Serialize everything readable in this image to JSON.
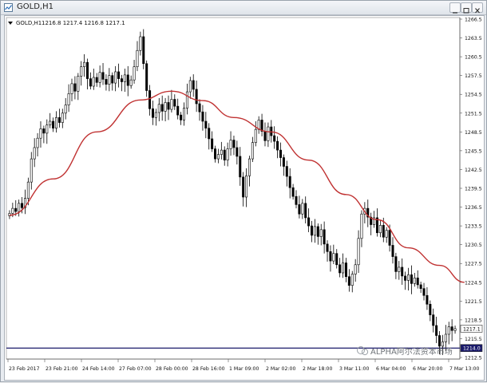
{
  "window": {
    "title": "GOLD,H1"
  },
  "chart_data": {
    "type": "candlestick",
    "symbol": "GOLD,H1",
    "info_line": "1216.8 1217.4 1216.8 1217.1",
    "ylim": [
      1212.5,
      1266.5
    ],
    "y_ticks": [
      "1266.5",
      "1263.5",
      "1260.5",
      "1257.5",
      "1254.5",
      "1251.5",
      "1248.5",
      "1245.5",
      "1242.5",
      "1239.5",
      "1236.5",
      "1233.5",
      "1230.5",
      "1227.5",
      "1224.5",
      "1221.5",
      "1218.5",
      "1215.5",
      "1212.5"
    ],
    "x_ticks": [
      "23 Feb 2017",
      "23 Feb 21:00",
      "24 Feb 14:00",
      "27 Feb 07:00",
      "28 Feb 00:00",
      "28 Feb 16:00",
      "1 Mar 09:00",
      "2 Mar 02:00",
      "2 Mar 18:00",
      "3 Mar 11:00",
      "6 Mar 04:00",
      "6 Mar 20:00",
      "7 Mar 13:00"
    ],
    "closes": [
      1235.5,
      1236.3,
      1235.8,
      1237.1,
      1236.4,
      1237.9,
      1240.5,
      1244.2,
      1246.0,
      1247.5,
      1249.0,
      1248.3,
      1249.6,
      1250.2,
      1249.1,
      1250.8,
      1250.0,
      1251.5,
      1252.8,
      1254.6,
      1256.2,
      1255.0,
      1257.4,
      1258.9,
      1259.6,
      1257.0,
      1255.8,
      1257.2,
      1256.4,
      1258.0,
      1256.9,
      1256.1,
      1257.5,
      1256.3,
      1258.1,
      1257.0,
      1256.5,
      1257.6,
      1255.9,
      1256.8,
      1258.9,
      1261.5,
      1263.7,
      1259.4,
      1255.1,
      1252.2,
      1250.8,
      1251.6,
      1252.9,
      1251.8,
      1253.2,
      1252.1,
      1253.7,
      1252.6,
      1251.2,
      1250.4,
      1252.3,
      1254.9,
      1256.7,
      1255.3,
      1253.0,
      1251.7,
      1250.2,
      1249.1,
      1247.4,
      1245.8,
      1244.2,
      1244.9,
      1245.6,
      1244.0,
      1245.8,
      1247.2,
      1246.0,
      1244.6,
      1241.3,
      1238.1,
      1241.5,
      1244.2,
      1246.8,
      1248.9,
      1250.4,
      1248.6,
      1247.1,
      1249.3,
      1247.9,
      1247.0,
      1245.6,
      1244.4,
      1243.0,
      1241.4,
      1239.6,
      1238.2,
      1236.9,
      1235.4,
      1237.1,
      1234.8,
      1233.5,
      1232.0,
      1233.4,
      1231.8,
      1232.9,
      1230.6,
      1229.4,
      1227.9,
      1229.1,
      1227.3,
      1226.0,
      1227.6,
      1225.4,
      1224.0,
      1225.8,
      1227.3,
      1231.5,
      1235.4,
      1236.3,
      1234.9,
      1233.7,
      1234.8,
      1232.4,
      1233.6,
      1231.7,
      1232.8,
      1230.4,
      1228.6,
      1226.2,
      1226.9,
      1225.5,
      1224.8,
      1225.7,
      1224.3,
      1225.2,
      1224.1,
      1223.5,
      1222.4,
      1221.0,
      1219.3,
      1217.6,
      1216.0,
      1214.3,
      1215.0,
      1216.2,
      1217.4,
      1216.8,
      1217.1
    ],
    "ma": {
      "color": "#c03232",
      "values": [
        [
          0,
          1235.2
        ],
        [
          14,
          1241.0
        ],
        [
          28,
          1248.5
        ],
        [
          42,
          1253.6
        ],
        [
          52,
          1255.0
        ],
        [
          62,
          1253.5
        ],
        [
          72,
          1250.8
        ],
        [
          84,
          1248.5
        ],
        [
          96,
          1244.0
        ],
        [
          108,
          1238.5
        ],
        [
          118,
          1234.5
        ],
        [
          128,
          1230.0
        ],
        [
          138,
          1227.2
        ],
        [
          146,
          1224.5
        ]
      ]
    },
    "price_labels": [
      {
        "value": "1217.1",
        "level": 1217.1,
        "bg": "#ffffff",
        "fg": "#000000"
      },
      {
        "value": "1214.0",
        "level": 1214.0,
        "bg": "#1a1a6a",
        "fg": "#ffffff"
      }
    ],
    "hline": {
      "level": 1214.0,
      "color": "#1a1a6a"
    },
    "watermark": "ALPHA阿尔法资本市场"
  }
}
